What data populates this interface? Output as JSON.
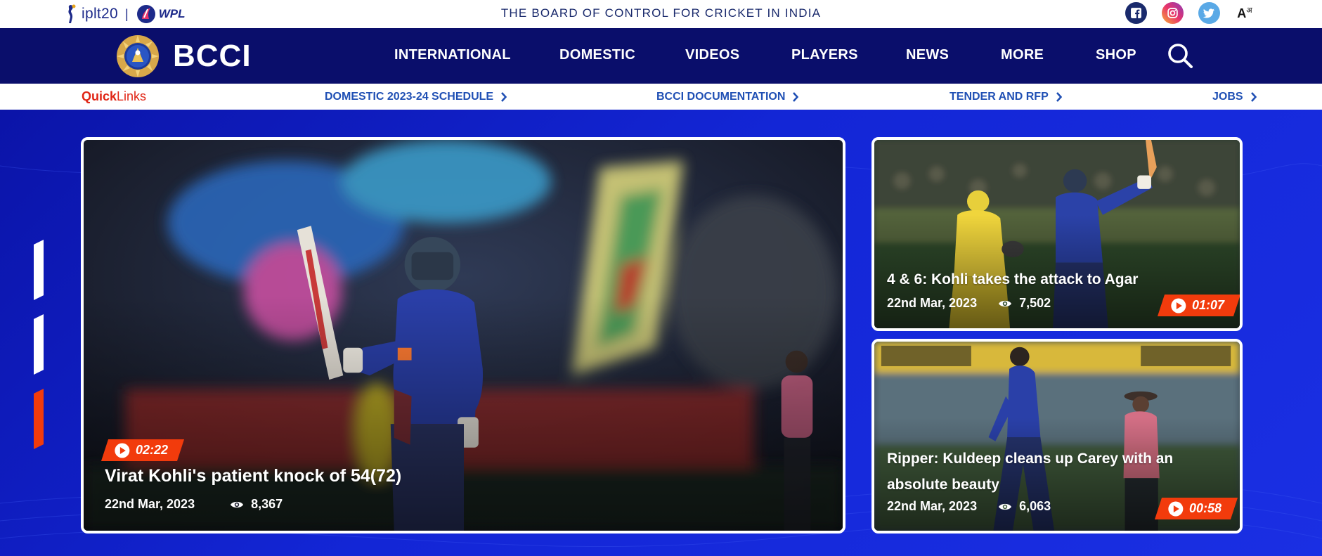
{
  "topbar": {
    "ipl_label": "iplt20",
    "separator": "|",
    "wpl_label": "WPL",
    "board_title": "THE BOARD OF CONTROL FOR CRICKET IN INDIA",
    "social": [
      {
        "name": "facebook-icon",
        "color": "#1a2a6c"
      },
      {
        "name": "instagram-icon",
        "color": "#e8336b"
      },
      {
        "name": "twitter-icon",
        "color": "#5aa9e6"
      }
    ],
    "language_toggle": "A",
    "language_toggle_sup": "अ"
  },
  "navbar": {
    "brand": "BCCI",
    "items": [
      "INTERNATIONAL",
      "DOMESTIC",
      "VIDEOS",
      "PLAYERS",
      "NEWS",
      "MORE",
      "SHOP"
    ],
    "search_icon": "search-icon"
  },
  "quicklinks": {
    "title_bold": "Quick",
    "title_rest": "Links",
    "links": [
      "DOMESTIC 2023-24 SCHEDULE",
      "BCCI DOCUMENTATION",
      "TENDER AND RFP",
      "JOBS"
    ]
  },
  "slider": {
    "active_index": 2,
    "count": 3,
    "colors": {
      "inactive": "#ffffff",
      "active": "#f23b0c"
    }
  },
  "videos": [
    {
      "duration": "02:22",
      "title": "Virat Kohli's patient knock of 54(72)",
      "date": "22nd Mar, 2023",
      "views": "8,367"
    },
    {
      "duration": "01:07",
      "title": "4 & 6: Kohli takes the attack to Agar",
      "date": "22nd Mar, 2023",
      "views": "7,502"
    },
    {
      "duration": "00:58",
      "title": "Ripper: Kuldeep cleans up Carey with an absolute beauty",
      "date": "22nd Mar, 2023",
      "views": "6,063"
    }
  ],
  "colors": {
    "navbar": "#0a0e6b",
    "hero": "#1326d6",
    "accent": "#f23b0c",
    "link": "#1f4fb4"
  }
}
